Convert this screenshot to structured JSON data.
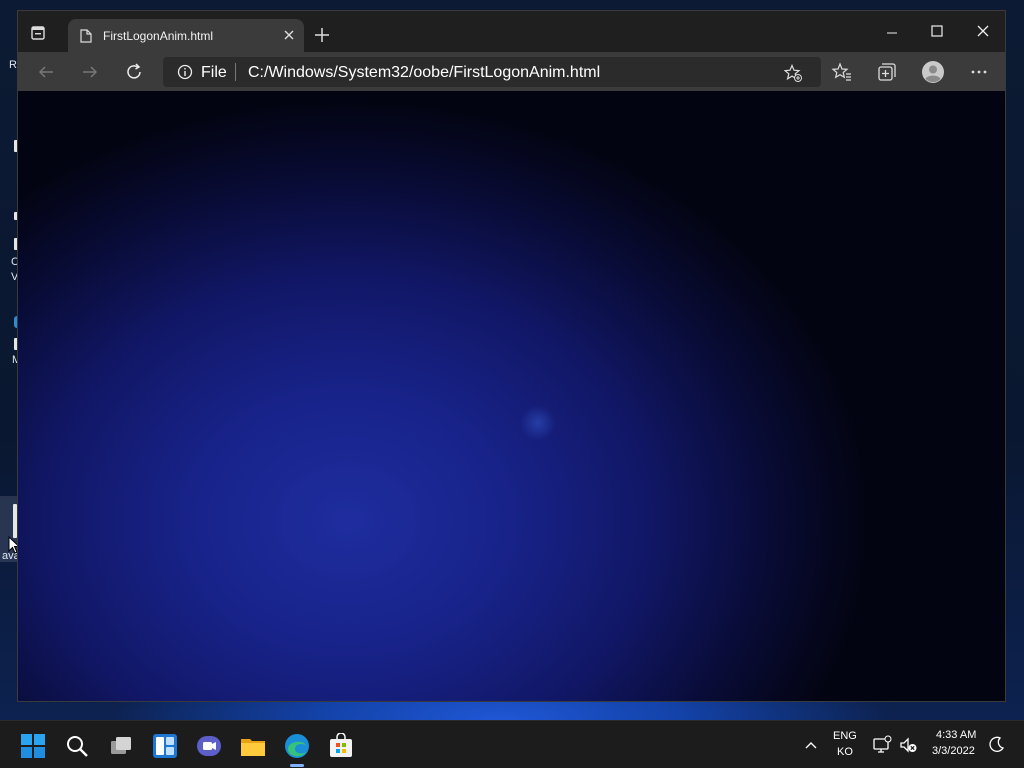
{
  "desktop": {
    "fragments": [
      "Re",
      "C",
      "V",
      "M",
      "ava"
    ]
  },
  "browser": {
    "tab_title": "FirstLogonAnim.html",
    "address": {
      "scheme_label": "File",
      "url": "C:/Windows/System32/oobe/FirstLogonAnim.html"
    },
    "icons": {
      "tab_actions": "tab-actions-icon",
      "close_tab": "close-icon",
      "new_tab": "plus-icon",
      "minimize": "minimize-icon",
      "maximize": "maximize-icon",
      "close_window": "close-icon",
      "back": "back-arrow-icon",
      "forward": "forward-arrow-icon",
      "refresh": "refresh-icon",
      "info": "info-icon",
      "add_favorite": "star-plus-icon",
      "favorites": "favorites-icon",
      "collections": "collections-icon",
      "profile": "profile-icon",
      "more": "more-icon"
    },
    "content_colors": [
      "#1e2d9e",
      "#111766",
      "#030412"
    ]
  },
  "taskbar": {
    "apps": [
      "start-icon",
      "search-icon",
      "task-view-icon",
      "widgets-icon",
      "chat-icon",
      "file-explorer-icon",
      "edge-icon",
      "store-icon"
    ],
    "language_line1": "ENG",
    "language_line2": "KO",
    "time": "4:33 AM",
    "date": "3/3/2022"
  }
}
